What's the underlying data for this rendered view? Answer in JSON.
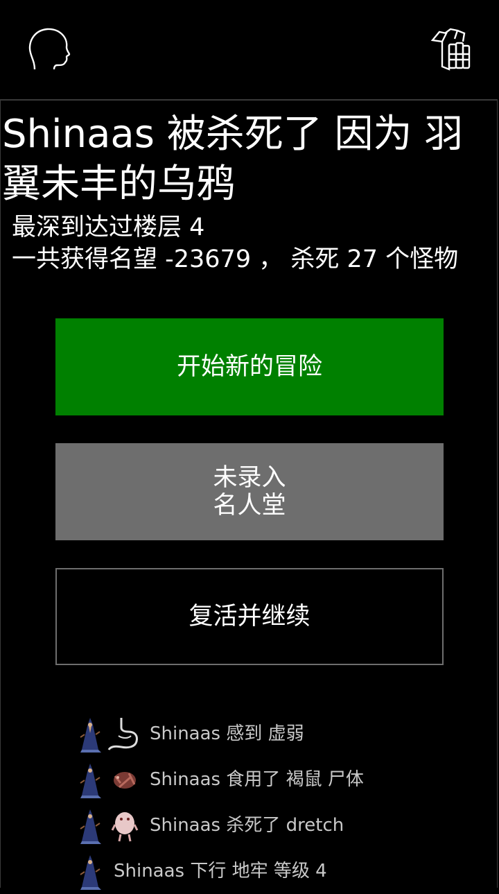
{
  "toolbar": {
    "left_icon": "head-outline-icon",
    "right_icon": "inventory-icon"
  },
  "death": {
    "title": "Shinaas 被杀死了 因为 羽翼未丰的乌鸦",
    "depth_line": "最深到达过楼层 4",
    "summary_line": "一共获得名望 -23679 ， 杀死 27 个怪物"
  },
  "buttons": {
    "new_adventure": "开始新的冒险",
    "hall_of_fame_line1": "未录入",
    "hall_of_fame_line2": "名人堂",
    "revive": "复活并继续"
  },
  "log": [
    {
      "text": "Shinaas 感到 虚弱",
      "icon": "stomach-icon"
    },
    {
      "text": "Shinaas 食用了 褐鼠 尸体",
      "icon": "rat-corpse-icon"
    },
    {
      "text": "Shinaas 杀死了 dretch",
      "icon": "dretch-monster-icon"
    },
    {
      "text": "Shinaas 下行 地牢 等级 4",
      "icon": ""
    }
  ],
  "colors": {
    "new_button": "#008000",
    "hof_button": "#6e6e6e",
    "log_text": "#c9c9c9"
  }
}
